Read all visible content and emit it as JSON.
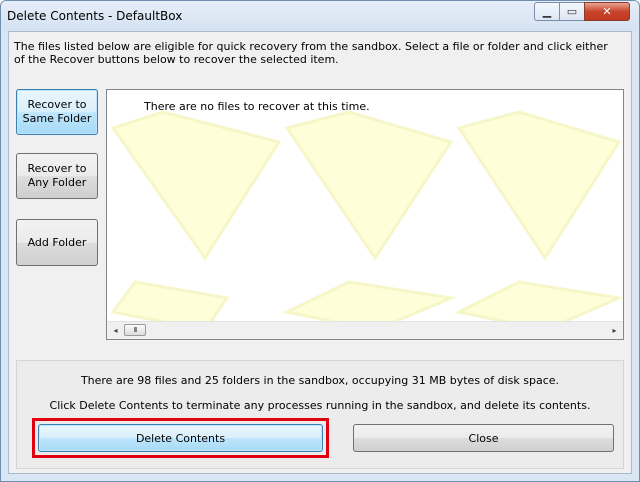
{
  "window": {
    "title": "Delete Contents - DefaultBox",
    "minimize_glyph": "▁",
    "maximize_glyph": "▭",
    "close_glyph": "✕"
  },
  "description": "The files listed below are eligible for quick recovery from the sandbox.  Select a file or folder and click either of the Recover buttons below to recover the selected item.",
  "side_buttons": {
    "recover_same": [
      "Recover to",
      "Same Folder"
    ],
    "recover_any": [
      "Recover to",
      "Any Folder"
    ],
    "add_folder": "Add Folder"
  },
  "recovery_list": {
    "empty_message": "There are no files to recover at this time.",
    "scroll_left_glyph": "◂",
    "scroll_right_glyph": "▸",
    "thumb_grip": "III"
  },
  "summary": {
    "stats_text": "There are 98 files and 25 folders in the sandbox, occupying 31 MB bytes of disk space.",
    "instruction_text": "Click Delete Contents to terminate any processes running in the sandbox, and delete its contents."
  },
  "buttons": {
    "delete_contents": "Delete Contents",
    "close": "Close"
  },
  "colors": {
    "highlight_border": "#e1000f",
    "watermark_fill": "#fefed8"
  }
}
